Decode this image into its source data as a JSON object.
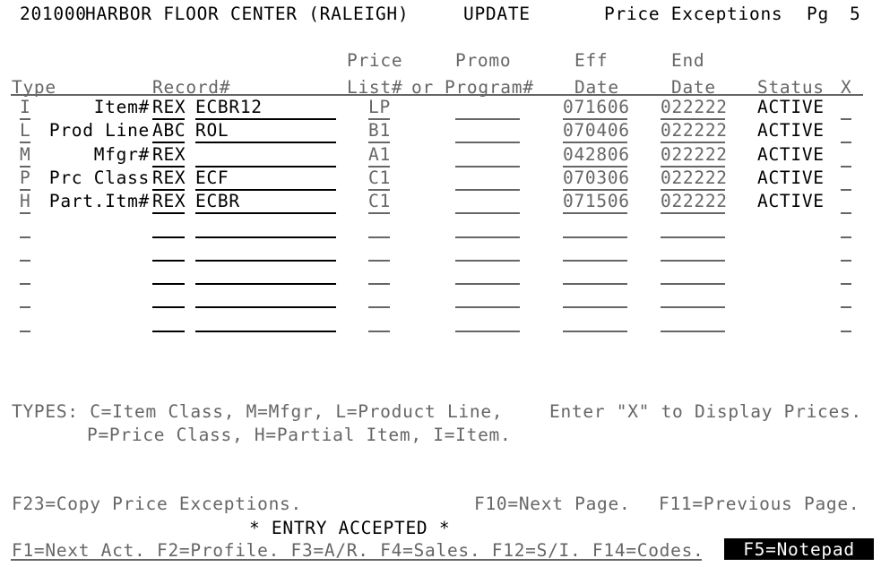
{
  "screen": {
    "id": "201000",
    "company": "HARBOR FLOOR CENTER (RALEIGH)",
    "mode": "UPDATE",
    "title": "Price Exceptions",
    "page_label": "Pg",
    "page_number": "5"
  },
  "colors": {
    "background": "#ffffff",
    "normal_text": "#000000",
    "dim_text": "#666666",
    "reverse_bg": "#000000",
    "reverse_fg": "#ffffff"
  },
  "columns": {
    "type": "Type",
    "record": "Record#",
    "price_top": "Price",
    "price_bottom": "List#",
    "or": "or",
    "promo_top": "Promo",
    "promo_bottom": "Program#",
    "eff_top": "Eff",
    "eff_bottom": "Date",
    "end_top": "End",
    "end_bottom": "Date",
    "status": "Status",
    "x": "X"
  },
  "rows": [
    {
      "type": "I",
      "label": "Item#",
      "prefix": "REX",
      "record": "ECBR12",
      "price_list": "LP",
      "promo": "",
      "eff_date": "071606",
      "end_date": "022222",
      "status": "ACTIVE",
      "x": ""
    },
    {
      "type": "L",
      "label": "Prod Line",
      "prefix": "ABC",
      "record": "ROL",
      "price_list": "B1",
      "promo": "",
      "eff_date": "070406",
      "end_date": "022222",
      "status": "ACTIVE",
      "x": ""
    },
    {
      "type": "M",
      "label": "Mfgr#",
      "prefix": "REX",
      "record": "",
      "price_list": "A1",
      "promo": "",
      "eff_date": "042806",
      "end_date": "022222",
      "status": "ACTIVE",
      "x": ""
    },
    {
      "type": "P",
      "label": "Prc Class",
      "prefix": "REX",
      "record": "ECF",
      "price_list": "C1",
      "promo": "",
      "eff_date": "070306",
      "end_date": "022222",
      "status": "ACTIVE",
      "x": ""
    },
    {
      "type": "H",
      "label": "Part.Itm#",
      "prefix": "REX",
      "record": "ECBR",
      "price_list": "C1",
      "promo": "",
      "eff_date": "071506",
      "end_date": "022222",
      "status": "ACTIVE",
      "x": ""
    },
    {
      "type": "",
      "label": "",
      "prefix": "",
      "record": "",
      "price_list": "",
      "promo": "",
      "eff_date": "",
      "end_date": "",
      "status": "",
      "x": ""
    },
    {
      "type": "",
      "label": "",
      "prefix": "",
      "record": "",
      "price_list": "",
      "promo": "",
      "eff_date": "",
      "end_date": "",
      "status": "",
      "x": ""
    },
    {
      "type": "",
      "label": "",
      "prefix": "",
      "record": "",
      "price_list": "",
      "promo": "",
      "eff_date": "",
      "end_date": "",
      "status": "",
      "x": ""
    },
    {
      "type": "",
      "label": "",
      "prefix": "",
      "record": "",
      "price_list": "",
      "promo": "",
      "eff_date": "",
      "end_date": "",
      "status": "",
      "x": ""
    },
    {
      "type": "",
      "label": "",
      "prefix": "",
      "record": "",
      "price_list": "",
      "promo": "",
      "eff_date": "",
      "end_date": "",
      "status": "",
      "x": ""
    }
  ],
  "legend": {
    "line1": "TYPES: C=Item Class, M=Mfgr, L=Product Line,",
    "line2": "P=Price Class, H=Partial Item, I=Item.",
    "hint": "Enter \"X\" to Display Prices."
  },
  "footer": {
    "f23": "F23=Copy Price Exceptions.",
    "f10": "F10=Next Page.",
    "f11": "F11=Previous Page.",
    "message": "* ENTRY ACCEPTED *",
    "keys": "F1=Next Act. F2=Profile. F3=A/R. F4=Sales. F12=S/I. F14=Codes.",
    "notepad": "F5=Notepad"
  }
}
